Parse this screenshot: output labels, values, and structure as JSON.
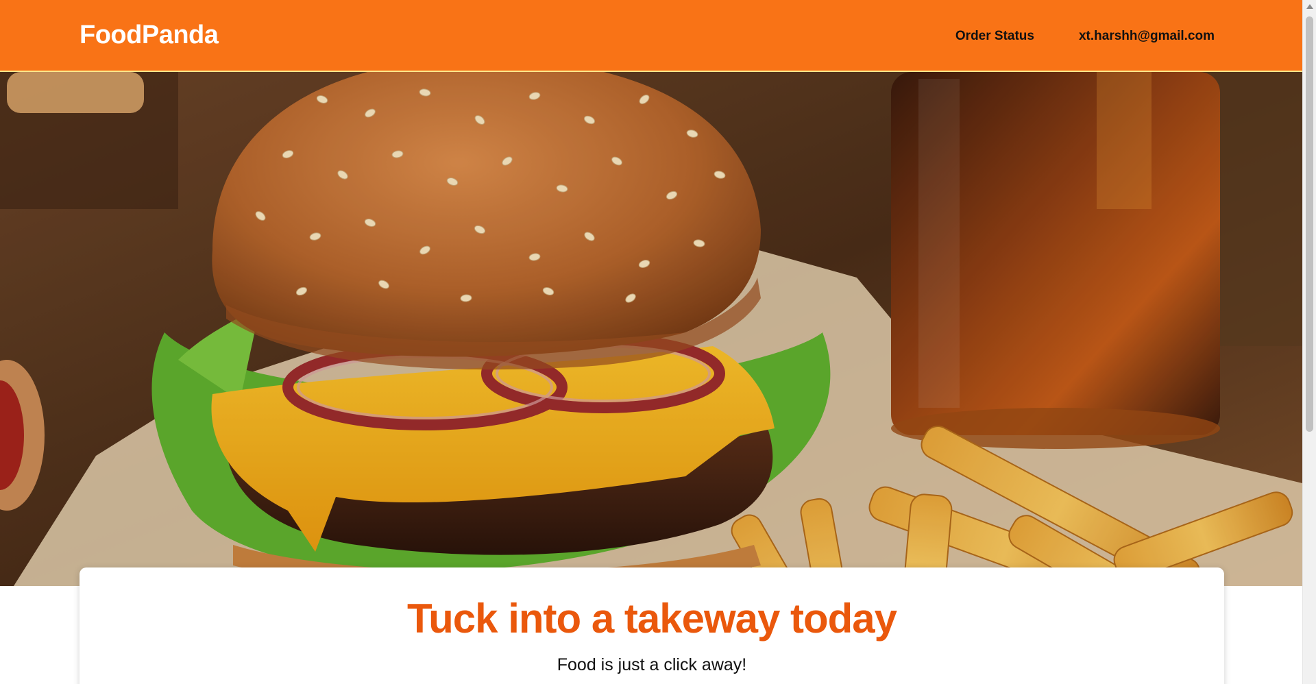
{
  "header": {
    "brand": "FoodPanda",
    "nav": {
      "order_status": "Order Status",
      "user_email": "xt.harshh@gmail.com"
    }
  },
  "hero": {
    "image_alt": "burger-fries-drink-photo"
  },
  "card": {
    "title": "Tuck into a takeway today",
    "subtitle": "Food is just a click away!"
  },
  "colors": {
    "brand_orange": "#f97316",
    "title_orange": "#ea580c"
  }
}
